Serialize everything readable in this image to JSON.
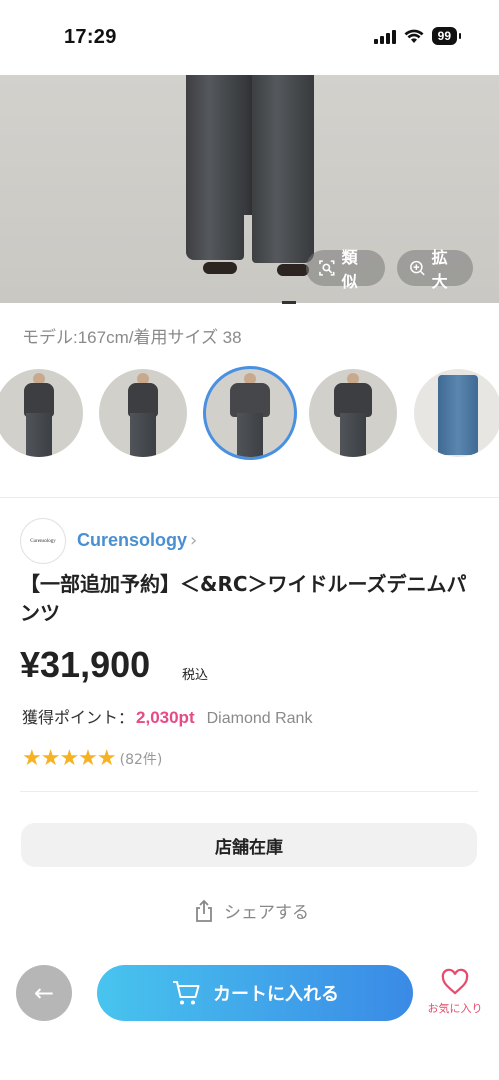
{
  "status_bar": {
    "time": "17:29",
    "battery": "99"
  },
  "hero": {
    "similar_label": "類似",
    "zoom_label": "拡大"
  },
  "model_note": "モデル:167cm/着用サイズ 38",
  "shop": {
    "logo_text": "Curensology",
    "name": "Curensology",
    "chevron": "›"
  },
  "product": {
    "title": "【一部追加予約】＜&RC＞ワイドルーズデニムパンツ",
    "price": "¥31,900",
    "tax_label": "税込",
    "points_label": "獲得ポイント：",
    "points_value": "2,030pt",
    "rank": "Diamond Rank",
    "stars": "★★★★★",
    "review_count": "(82件)"
  },
  "actions": {
    "store_stock": "店舗在庫",
    "share": "シェアする",
    "back_arrow": "←",
    "add_to_cart": "カートに入れる",
    "favorite": "お気に入り"
  },
  "colors": {
    "accent_blue": "#4a8fd1",
    "points_pink": "#e74a84",
    "star_gold": "#f5b324",
    "cart_gradient_start": "#48c4ee",
    "cart_gradient_end": "#3a8ae6"
  },
  "icons": [
    "similar-search-icon",
    "zoom-icon",
    "share-icon",
    "cart-icon",
    "back-arrow-icon",
    "heart-icon"
  ]
}
